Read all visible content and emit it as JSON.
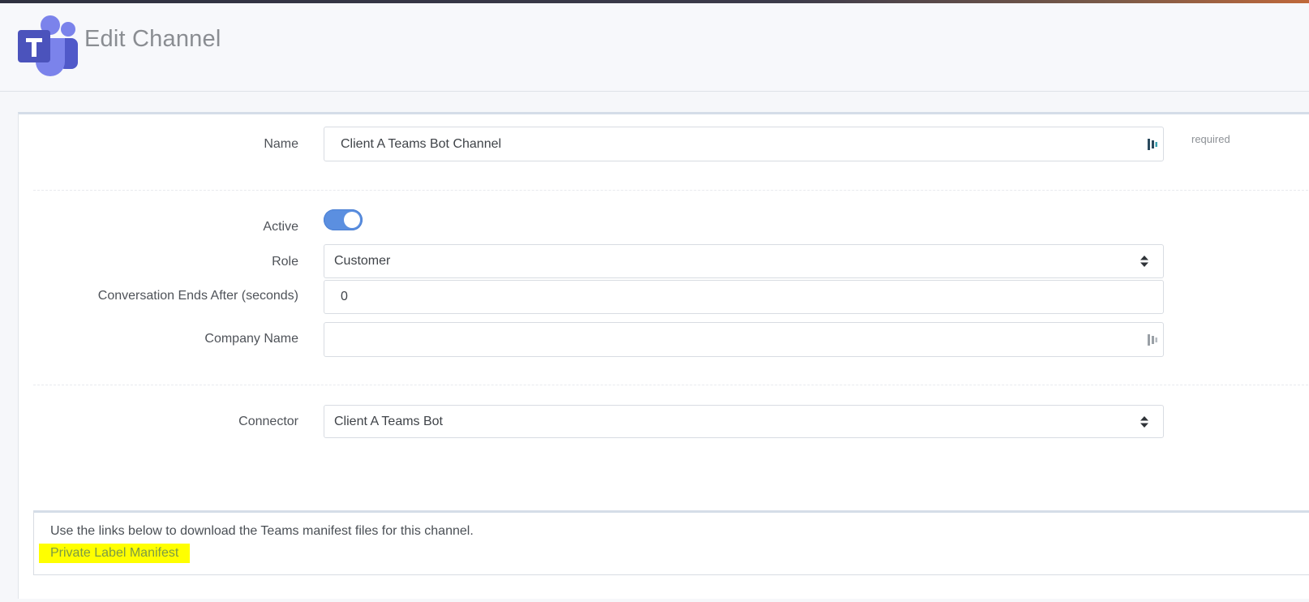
{
  "header": {
    "title": "Edit Channel",
    "logo": "microsoft-teams-logo"
  },
  "form": {
    "name": {
      "label": "Name",
      "value": "Client A Teams Bot Channel",
      "hint": "required",
      "icon": "lastpass-icon"
    },
    "active": {
      "label": "Active",
      "enabled": true
    },
    "role": {
      "label": "Role",
      "selected": "Customer",
      "icon": "select-arrows-icon"
    },
    "conversation_ends": {
      "label": "Conversation Ends After (seconds)",
      "value": "0"
    },
    "company_name": {
      "label": "Company Name",
      "value": "",
      "icon": "lastpass-icon"
    },
    "connector": {
      "label": "Connector",
      "selected": "Client A Teams Bot",
      "icon": "select-arrows-icon"
    }
  },
  "manifest": {
    "description": "Use the links below to download the Teams manifest files for this channel.",
    "link_label": "Private Label Manifest",
    "highlight_color": "#ffff00"
  },
  "colors": {
    "toggle_on": "#5b8fe0",
    "link": "#7b9a45",
    "teams_purple": "#5059c9"
  }
}
